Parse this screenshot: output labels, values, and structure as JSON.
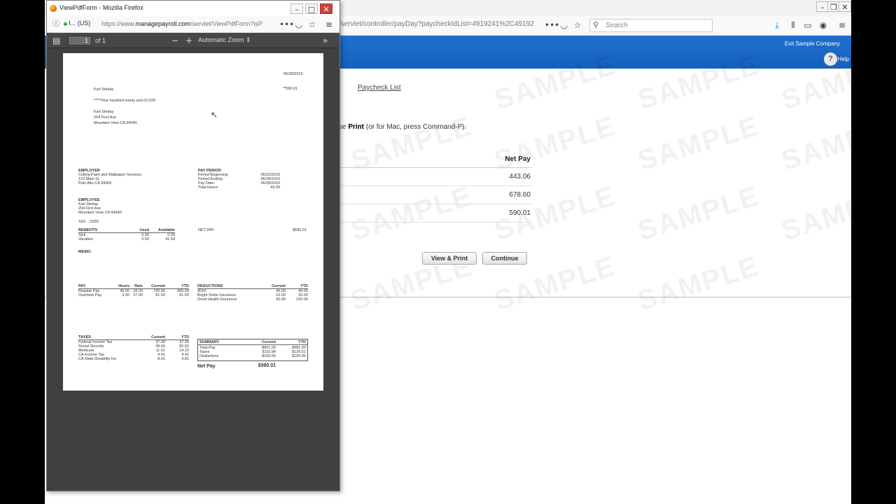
{
  "bg_window": {
    "url": "/servlet/controller/payDay?paycheckIdList=4919241%2C49192",
    "search_placeholder": "Search",
    "exit_link": "Exit Sample Company",
    "help_label": "Help",
    "help_glyph": "?",
    "breadcrumb": "Paycheck List",
    "instructions_prefix": "se ",
    "instructions_bold": "Print",
    "instructions_suffix": " (or for Mac, press Command-P).",
    "net_pay_header": "Net Pay",
    "net_pay_values": [
      "443.06",
      "678.60",
      "590.01"
    ],
    "view_print_button": "View & Print",
    "continue_button": "Continue",
    "watermark_text": "SAMPLE"
  },
  "pdf_window": {
    "title": "ViewPdfForm - Mozilla Firefox",
    "security": "(US)",
    "url_prefix": "https://www.",
    "url_host": "managepayroll.com",
    "url_path": "/servlet/ViewPdfForm?isP",
    "page_number": "1",
    "page_of": "of 1",
    "zoom": "Automatic Zoom"
  },
  "check": {
    "date": "06/28/2019",
    "payee": "Karl Stebay",
    "amount": "**590.01",
    "amount_words": "*****Five hundred ninety and 01/100",
    "address": [
      "Karl Stebay",
      "204 First Ave",
      "Mountain View CA 94040"
    ]
  },
  "stub": {
    "employer_label": "EMPLOYER",
    "employer": [
      "Collins Paint and Wallpaper Services",
      "123 Main St",
      "Palo Alto CA 94306"
    ],
    "pay_period_label": "PAY PERIOD",
    "pay_period": [
      {
        "label": "Period Beginning:",
        "value": "06/22/2019"
      },
      {
        "label": "Period Ending:",
        "value": "06/28/2019"
      },
      {
        "label": "Pay Date:",
        "value": "06/28/2019"
      },
      {
        "label": "Total Hours:",
        "value": "43.00"
      }
    ],
    "employee_label": "EMPLOYEE",
    "employee": [
      "Karl Stebay",
      "204 First Ave",
      "Mountain View CA 94040"
    ],
    "ssn": "SS# ...3333",
    "benefits": {
      "header": [
        "BENEFITS",
        "Used",
        "Available"
      ],
      "rows": [
        [
          "Sick",
          "0.00",
          "0.00"
        ],
        [
          "Vacation",
          "0.00",
          "41.54"
        ]
      ]
    },
    "net_pay_label": "NET PAY:",
    "net_pay_value": "$590.01",
    "memo_label": "MEMO:",
    "pay": {
      "header": [
        "PAY",
        "Hours",
        "Rate",
        "Current",
        "YTD"
      ],
      "rows": [
        [
          "Regular Pay",
          "40.00",
          "18.00",
          "720.00",
          "900.00"
        ],
        [
          "Overtime Pay",
          "3.00",
          "27.00",
          "81.00",
          "81.00"
        ]
      ]
    },
    "deductions": {
      "header": [
        "DEDUCTIONS",
        "Current",
        "YTD"
      ],
      "rows": [
        [
          "401K",
          "40.05",
          "49.05"
        ],
        [
          "Bright Smile Insurance",
          "10.00",
          "20.00"
        ],
        [
          "Good Health Insurance",
          "50.00",
          "100.00"
        ]
      ]
    },
    "taxes": {
      "header": [
        "TAXES",
        "Current",
        "YTD"
      ],
      "rows": [
        [
          "Federal Income Tax",
          "37.28",
          "37.28"
        ],
        [
          "Social Security",
          "49.66",
          "60.82"
        ],
        [
          "Medicare",
          "11.61",
          "14.22"
        ],
        [
          "CA Income Tax",
          "4.41",
          "4.41"
        ],
        [
          "CA State Disability Ins",
          "8.01",
          "9.81"
        ]
      ]
    },
    "summary": {
      "header": [
        "SUMMARY",
        "Current",
        "YTD"
      ],
      "rows": [
        [
          "Total Pay",
          "$801.00",
          "$981.00"
        ],
        [
          "Taxes",
          "$110.94",
          "$126.51"
        ],
        [
          "Deductions",
          "$100.05",
          "$169.05"
        ]
      ]
    },
    "bottom_net_label": "Net Pay",
    "bottom_net_value": "$590.01"
  }
}
